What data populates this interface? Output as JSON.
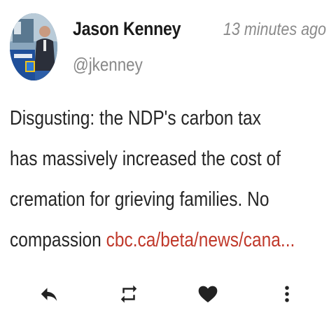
{
  "tweet": {
    "author": {
      "display_name": "Jason Kenney",
      "handle": "@jkenney"
    },
    "timestamp": "13 minutes ago",
    "body": {
      "line1": "Disgusting: the NDP's carbon tax",
      "line2": "has massively increased the cost of",
      "line3": "cremation for grieving families. No",
      "line4_text": "compassion ",
      "link": "cbc.ca/beta/news/cana..."
    },
    "actions": [
      {
        "name": "reply",
        "icon": "reply-icon"
      },
      {
        "name": "retweet",
        "icon": "retweet-icon"
      },
      {
        "name": "like",
        "icon": "heart-icon"
      },
      {
        "name": "more",
        "icon": "more-vertical-icon"
      }
    ]
  },
  "colors": {
    "link": "#c0392b",
    "name": "#1a1a1a",
    "muted": "#888888",
    "icon": "#222222"
  }
}
